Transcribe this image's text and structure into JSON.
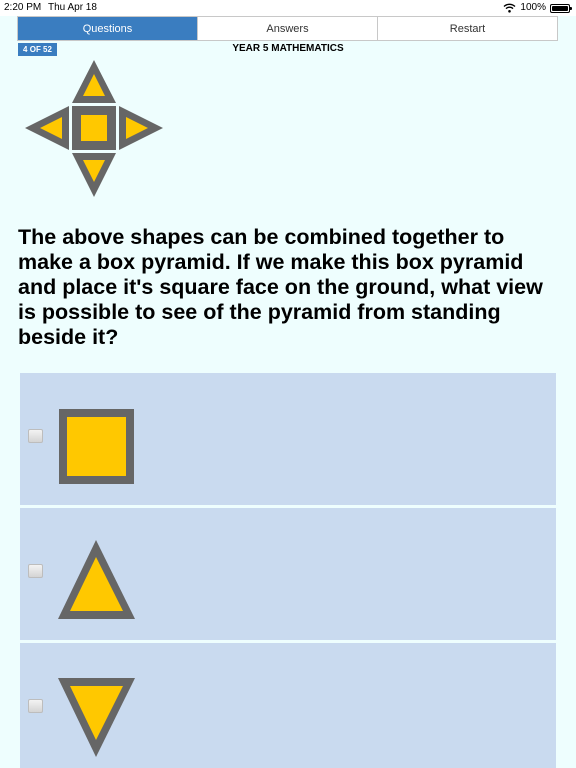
{
  "status_bar": {
    "time": "2:20 PM",
    "date": "Thu Apr 18",
    "battery": "100%"
  },
  "tabs": [
    {
      "label": "Questions",
      "active": true
    },
    {
      "label": "Answers",
      "active": false
    },
    {
      "label": "Restart",
      "active": false
    }
  ],
  "counter": "4 OF 52",
  "subject": "YEAR 5 MATHEMATICS",
  "question": "The above shapes can be combined together to make a box pyramid. If we make this box pyramid and place it's square face on the ground, what view is possible to see of the pyramid from standing beside it?",
  "answers": [
    {
      "shape": "square"
    },
    {
      "shape": "triangle-up"
    },
    {
      "shape": "triangle-down"
    }
  ],
  "colors": {
    "accent": "#3a7dc0",
    "shape_fill": "#ffc800",
    "shape_border": "#666666",
    "option_bg": "#c9daef",
    "page_bg": "#eefefe"
  }
}
